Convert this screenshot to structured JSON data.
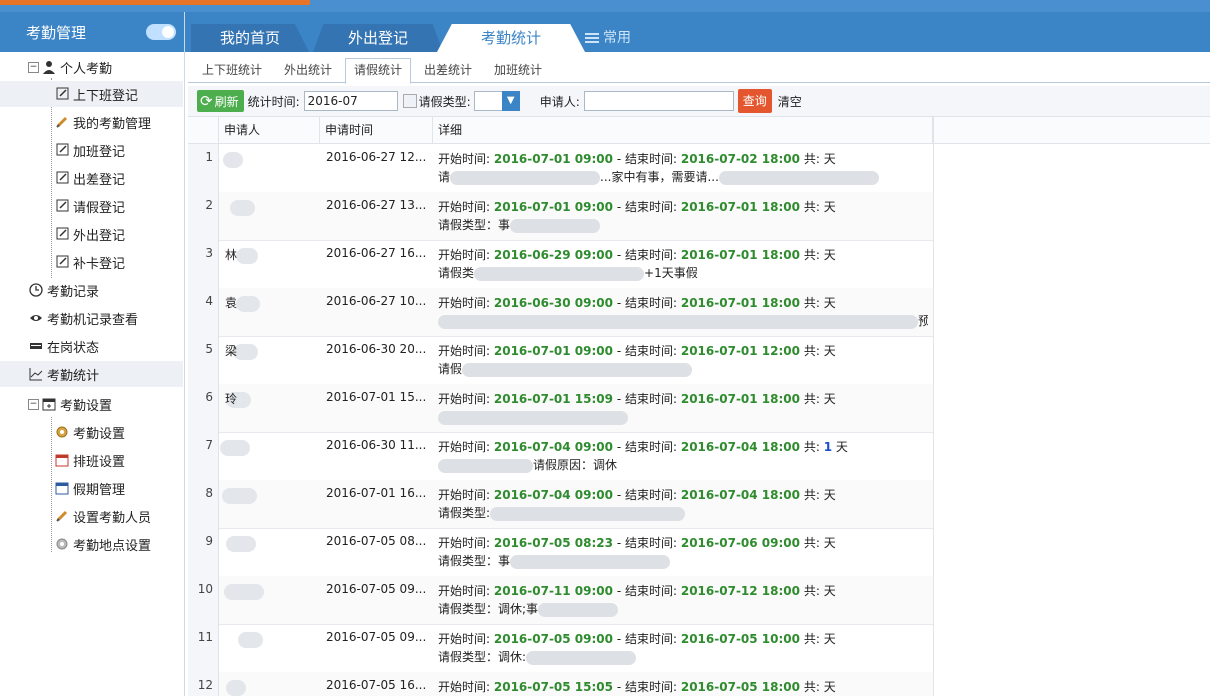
{
  "sidebar": {
    "title": "考勤管理",
    "items": [
      {
        "label": "个人考勤",
        "icon": "person-icon"
      },
      {
        "label": "上下班登记",
        "icon": "edit-icon"
      },
      {
        "label": "我的考勤管理",
        "icon": "pencil-icon"
      },
      {
        "label": "加班登记",
        "icon": "edit-icon"
      },
      {
        "label": "出差登记",
        "icon": "edit-icon"
      },
      {
        "label": "请假登记",
        "icon": "edit-icon"
      },
      {
        "label": "外出登记",
        "icon": "edit-icon"
      },
      {
        "label": "补卡登记",
        "icon": "edit-icon"
      },
      {
        "label": "考勤记录",
        "icon": "clock-icon"
      },
      {
        "label": "考勤机记录查看",
        "icon": "eye-icon"
      },
      {
        "label": "在岗状态",
        "icon": "card-icon"
      },
      {
        "label": "考勤统计",
        "icon": "chart-icon"
      },
      {
        "label": "考勤设置",
        "icon": "calendar-plus-icon"
      },
      {
        "label": "考勤设置",
        "icon": "gear-icon"
      },
      {
        "label": "排班设置",
        "icon": "calendar-icon"
      },
      {
        "label": "假期管理",
        "icon": "calendar-icon"
      },
      {
        "label": "设置考勤人员",
        "icon": "pencil-icon"
      },
      {
        "label": "考勤地点设置",
        "icon": "gear-icon"
      }
    ]
  },
  "tabs": {
    "home": "我的首页",
    "outing": "外出登记",
    "stats": "考勤统计",
    "common": "常用"
  },
  "subtabs": [
    "上下班统计",
    "外出统计",
    "请假统计",
    "出差统计",
    "加班统计"
  ],
  "toolbar": {
    "refresh": "刷新",
    "time_label": "统计时间:",
    "time_value": "2016-07",
    "type_label": "请假类型:",
    "applicant_label": "申请人:",
    "query": "查询",
    "clear": "清空"
  },
  "grid": {
    "columns": [
      "申请人",
      "申请时间",
      "详细"
    ],
    "start_label": "开始时间:",
    "end_label": "结束时间:",
    "total_label": "共:",
    "unit": "天",
    "rows": [
      {
        "num": "1",
        "name": "",
        "time": "2016-06-27 12...",
        "start": "2016-07-01 09:00",
        "end": "2016-07-02 18:00",
        "days": "",
        "line2_prefix": "请",
        "line2_suffix": "...家中有事，需要请..."
      },
      {
        "num": "2",
        "name": "",
        "time": "2016-06-27 13...",
        "start": "2016-07-01 09:00",
        "end": "2016-07-01 18:00",
        "days": "",
        "line2_prefix": "请假类型：事",
        "line2_suffix": ""
      },
      {
        "num": "3",
        "name": "林",
        "time": "2016-06-27 16...",
        "start": "2016-06-29 09:00",
        "end": "2016-07-01 18:00",
        "days": "",
        "line2_prefix": "请假类",
        "line2_suffix": "+1天事假"
      },
      {
        "num": "4",
        "name": "袁",
        "time": "2016-06-27 10...",
        "start": "2016-06-30 09:00",
        "end": "2016-07-01 18:00",
        "days": "",
        "line2_prefix": "",
        "line2_suffix": "预好，望批..."
      },
      {
        "num": "5",
        "name": "梁",
        "time": "2016-06-30 20...",
        "start": "2016-07-01 09:00",
        "end": "2016-07-01 12:00",
        "days": "",
        "line2_prefix": "请假",
        "line2_suffix": ""
      },
      {
        "num": "6",
        "name": "玲",
        "time": "2016-07-01 15...",
        "start": "2016-07-01 15:09",
        "end": "2016-07-01 18:00",
        "days": "",
        "line2_prefix": "",
        "line2_suffix": ""
      },
      {
        "num": "7",
        "name": "",
        "time": "2016-06-30 11...",
        "start": "2016-07-04 09:00",
        "end": "2016-07-04 18:00",
        "days": "1",
        "line2_prefix": "",
        "line2_suffix": "请假原因：调休"
      },
      {
        "num": "8",
        "name": "",
        "time": "2016-07-01 16...",
        "start": "2016-07-04 09:00",
        "end": "2016-07-04 18:00",
        "days": "",
        "line2_prefix": "请假类型:",
        "line2_suffix": ""
      },
      {
        "num": "9",
        "name": "",
        "time": "2016-07-05 08...",
        "start": "2016-07-05 08:23",
        "end": "2016-07-06 09:00",
        "days": "",
        "line2_prefix": "请假类型：事",
        "line2_suffix": ""
      },
      {
        "num": "10",
        "name": "",
        "time": "2016-07-05 09...",
        "start": "2016-07-11 09:00",
        "end": "2016-07-12 18:00",
        "days": "",
        "line2_prefix": "请假类型：调休;",
        "line2_suffix": "事"
      },
      {
        "num": "11",
        "name": "",
        "time": "2016-07-05 09...",
        "start": "2016-07-05 09:00",
        "end": "2016-07-05 10:00",
        "days": "",
        "line2_prefix": "请假类型：调休",
        "line2_suffix": ":"
      },
      {
        "num": "12",
        "name": "",
        "time": "2016-07-05 16...",
        "start": "2016-07-05 15:05",
        "end": "2016-07-05 18:00",
        "days": "",
        "line2_prefix": "",
        "line2_suffix": ""
      }
    ]
  }
}
